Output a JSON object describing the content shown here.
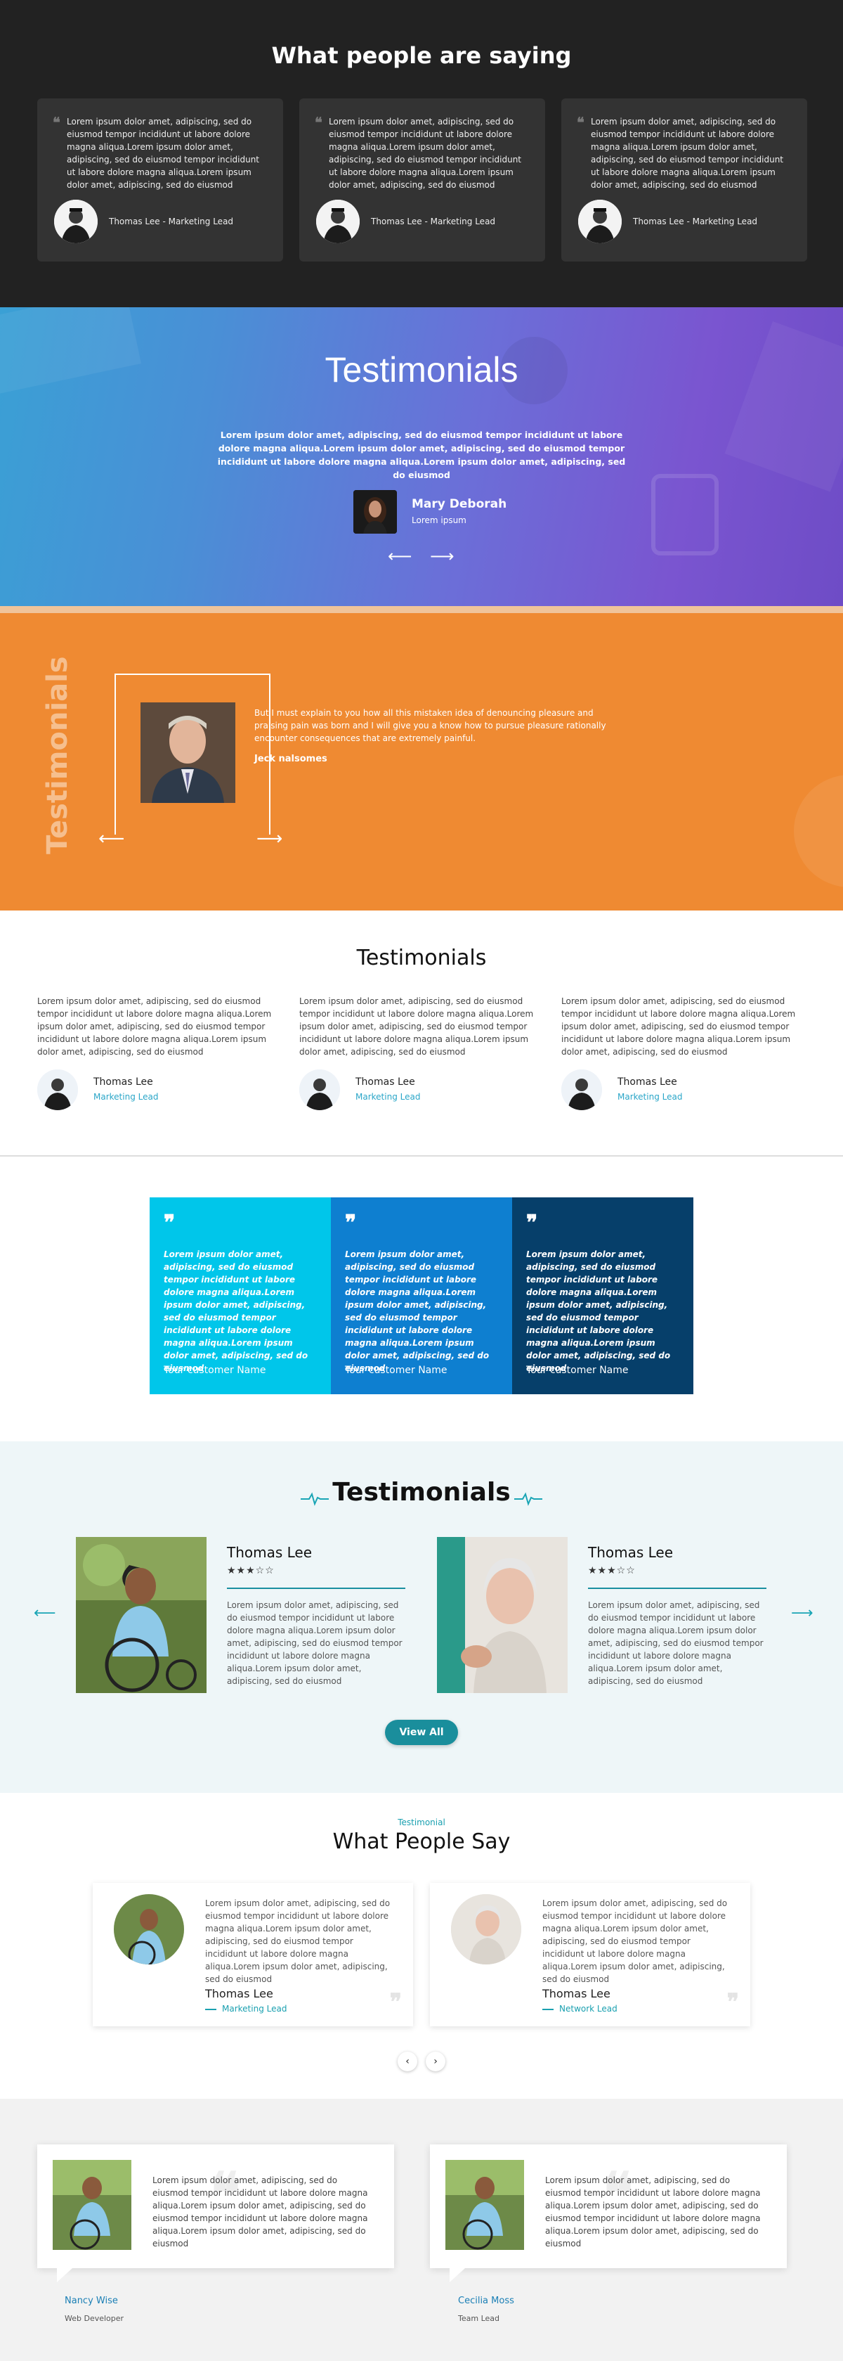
{
  "dark": {
    "title": "What people are saying",
    "cards": [
      {
        "text": "Lorem ipsum dolor amet, adipiscing, sed do eiusmod tempor incididunt ut labore dolore magna aliqua.Lorem ipsum dolor amet, adipiscing, sed do eiusmod tempor incididunt ut labore dolore magna aliqua.Lorem ipsum dolor amet, adipiscing, sed do eiusmod",
        "name": "Thomas Lee - Marketing Lead"
      },
      {
        "text": "Lorem ipsum dolor amet, adipiscing, sed do eiusmod tempor incididunt ut labore dolore magna aliqua.Lorem ipsum dolor amet, adipiscing, sed do eiusmod tempor incididunt ut labore dolore magna aliqua.Lorem ipsum dolor amet, adipiscing, sed do eiusmod",
        "name": "Thomas Lee - Marketing Lead"
      },
      {
        "text": "Lorem ipsum dolor amet, adipiscing, sed do eiusmod tempor incididunt ut labore dolore magna aliqua.Lorem ipsum dolor amet, adipiscing, sed do eiusmod tempor incididunt ut labore dolore magna aliqua.Lorem ipsum dolor amet, adipiscing, sed do eiusmod",
        "name": "Thomas Lee - Marketing Lead"
      }
    ]
  },
  "gradient": {
    "title": "Testimonials",
    "text": "Lorem ipsum dolor amet, adipiscing, sed do eiusmod tempor incididunt ut labore dolore magna aliqua.Lorem ipsum dolor amet, adipiscing, sed do eiusmod tempor incididunt ut labore dolore magna aliqua.Lorem ipsum dolor amet, adipiscing, sed do eiusmod",
    "name": "Mary Deborah",
    "role": "Lorem ipsum"
  },
  "orange": {
    "vertical_title": "Testimonials",
    "text": "But I must explain to you how all this mistaken idea of denouncing pleasure and praising pain was born and I will give you a know how to pursue pleasure rationally encounter consequences that are extremely painful.",
    "name": "Jeck nalsomes"
  },
  "white": {
    "title": "Testimonials",
    "cols": [
      {
        "text": "Lorem ipsum dolor amet, adipiscing, sed do eiusmod tempor incididunt ut labore dolore magna aliqua.Lorem ipsum dolor amet, adipiscing, sed do eiusmod tempor incididunt ut labore dolore magna aliqua.Lorem ipsum dolor amet, adipiscing, sed do eiusmod",
        "name": "Thomas Lee",
        "role": "Marketing Lead"
      },
      {
        "text": "Lorem ipsum dolor amet, adipiscing, sed do eiusmod tempor incididunt ut labore dolore magna aliqua.Lorem ipsum dolor amet, adipiscing, sed do eiusmod tempor incididunt ut labore dolore magna aliqua.Lorem ipsum dolor amet, adipiscing, sed do eiusmod",
        "name": "Thomas Lee",
        "role": "Marketing Lead"
      },
      {
        "text": "Lorem ipsum dolor amet, adipiscing, sed do eiusmod tempor incididunt ut labore dolore magna aliqua.Lorem ipsum dolor amet, adipiscing, sed do eiusmod tempor incididunt ut labore dolore magna aliqua.Lorem ipsum dolor amet, adipiscing, sed do eiusmod",
        "name": "Thomas Lee",
        "role": "Marketing Lead"
      }
    ]
  },
  "blocks": [
    {
      "text": "Lorem ipsum dolor amet, adipiscing, sed do eiusmod tempor incididunt ut labore dolore magna aliqua.Lorem ipsum dolor amet, adipiscing, sed do eiusmod tempor incididunt ut labore dolore magna aliqua.Lorem ipsum dolor amet, adipiscing, sed do eiusmod",
      "name": "Tour customer Name",
      "color": "#00c6ea"
    },
    {
      "text": "Lorem ipsum dolor amet, adipiscing, sed do eiusmod tempor incididunt ut labore dolore magna aliqua.Lorem ipsum dolor amet, adipiscing, sed do eiusmod tempor incididunt ut labore dolore magna aliqua.Lorem ipsum dolor amet, adipiscing, sed do eiusmod",
      "name": "Tour customer Name",
      "color": "#0e7fd0"
    },
    {
      "text": "Lorem ipsum dolor amet, adipiscing, sed do eiusmod tempor incididunt ut labore dolore magna aliqua.Lorem ipsum dolor amet, adipiscing, sed do eiusmod tempor incididunt ut labore dolore magna aliqua.Lorem ipsum dolor amet, adipiscing, sed do eiusmod",
      "name": "Tour customer Name",
      "color": "#063f6a"
    }
  ],
  "medical": {
    "title": "Testimonials",
    "cards": [
      {
        "name": "Thomas Lee",
        "stars": "★★★☆☆",
        "text": "Lorem ipsum dolor amet, adipiscing, sed do eiusmod tempor incididunt ut labore dolore magna aliqua.Lorem ipsum dolor amet, adipiscing, sed do eiusmod tempor incididunt ut labore dolore magna aliqua.Lorem ipsum dolor amet, adipiscing, sed do eiusmod"
      },
      {
        "name": "Thomas Lee",
        "stars": "★★★☆☆",
        "text": "Lorem ipsum dolor amet, adipiscing, sed do eiusmod tempor incididunt ut labore dolore magna aliqua.Lorem ipsum dolor amet, adipiscing, sed do eiusmod tempor incididunt ut labore dolore magna aliqua.Lorem ipsum dolor amet, adipiscing, sed do eiusmod"
      }
    ],
    "button": "View All",
    "accent": "#1a8e9c"
  },
  "people": {
    "kicker": "Testimonial",
    "title": "What People Say",
    "cards": [
      {
        "text": "Lorem ipsum dolor amet, adipiscing, sed do eiusmod tempor incididunt ut labore dolore magna aliqua.Lorem ipsum dolor amet, adipiscing, sed do eiusmod tempor incididunt ut labore dolore magna aliqua.Lorem ipsum dolor amet, adipiscing, sed do eiusmod",
        "name": "Thomas Lee",
        "role": "Marketing Lead"
      },
      {
        "text": "Lorem ipsum dolor amet, adipiscing, sed do eiusmod tempor incididunt ut labore dolore magna aliqua.Lorem ipsum dolor amet, adipiscing, sed do eiusmod tempor incididunt ut labore dolore magna aliqua.Lorem ipsum dolor amet, adipiscing, sed do eiusmod",
        "name": "Thomas Lee",
        "role": "Network Lead"
      }
    ],
    "prev": "‹",
    "next": "›"
  },
  "gray": {
    "cards": [
      {
        "text": "Lorem ipsum dolor amet, adipiscing, sed do eiusmod tempor incididunt ut labore dolore magna aliqua.Lorem ipsum dolor amet, adipiscing, sed do eiusmod tempor incididunt ut labore dolore magna aliqua.Lorem ipsum dolor amet, adipiscing, sed do eiusmod",
        "name": "Nancy Wise",
        "role": "Web Developer"
      },
      {
        "text": "Lorem ipsum dolor amet, adipiscing, sed do eiusmod tempor incididunt ut labore dolore magna aliqua.Lorem ipsum dolor amet, adipiscing, sed do eiusmod tempor incididunt ut labore dolore magna aliqua.Lorem ipsum dolor amet, adipiscing, sed do eiusmod",
        "name": "Cecilia Moss",
        "role": "Team Lead"
      }
    ]
  }
}
